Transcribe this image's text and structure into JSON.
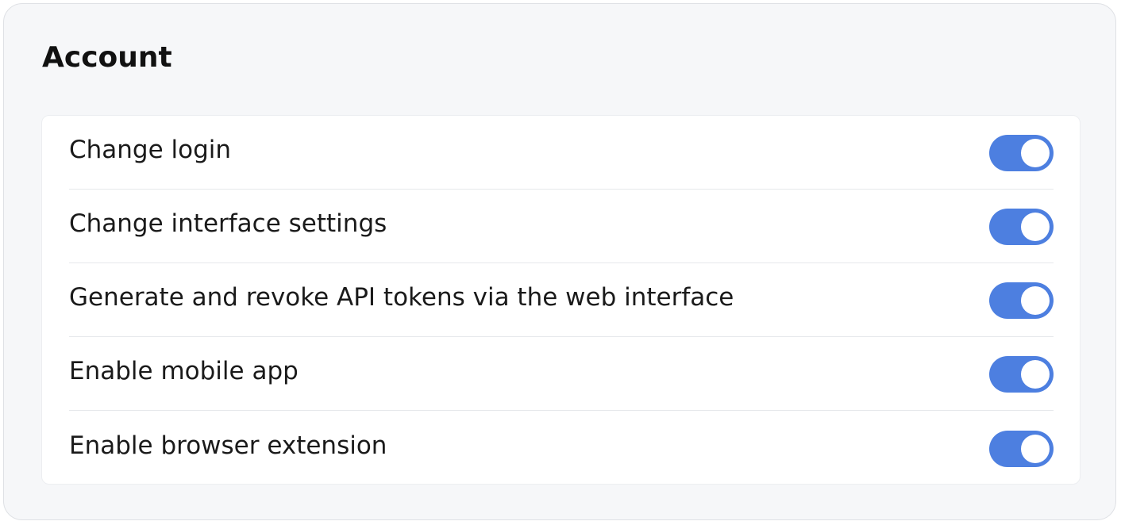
{
  "section": {
    "title": "Account"
  },
  "colors": {
    "toggle_on": "#4d7fe0",
    "panel_bg": "#f6f7f9",
    "card_bg": "#ffffff"
  },
  "settings": [
    {
      "label": "Change login",
      "enabled": true
    },
    {
      "label": "Change interface settings",
      "enabled": true
    },
    {
      "label": "Generate and revoke API tokens via the web interface",
      "enabled": true
    },
    {
      "label": "Enable mobile app",
      "enabled": true
    },
    {
      "label": "Enable browser extension",
      "enabled": true
    }
  ]
}
